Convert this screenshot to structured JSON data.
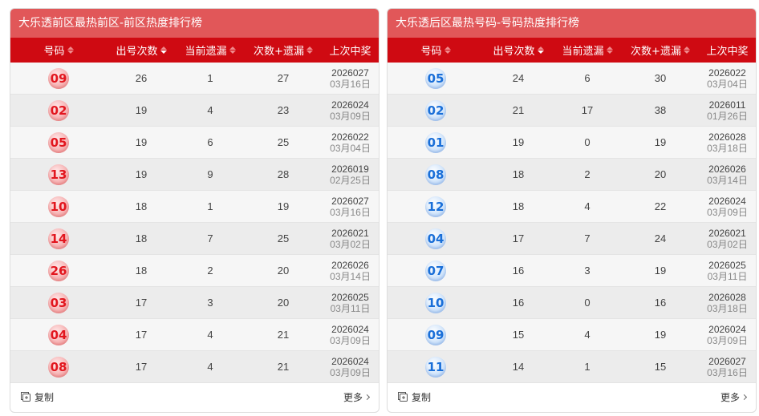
{
  "colors": {
    "header_red": "#cf0a12",
    "title_red": "#e15759",
    "front_ball": "#e2161e",
    "back_ball": "#1a6fd8"
  },
  "icons": {
    "sort": "sort-arrows-icon",
    "copy": "copy-icon",
    "more": "chevron-right-icon"
  },
  "front": {
    "title": "大乐透前区最热前区-前区热度排行榜",
    "headers": {
      "number": "号码",
      "count": "出号次数",
      "miss": "当前遗漏",
      "sum": "次数+遗漏",
      "last": "上次中奖"
    },
    "rows": [
      {
        "ball": "09",
        "count": "26",
        "miss": "1",
        "sum": "27",
        "issue": "2026027",
        "date": "03月16日"
      },
      {
        "ball": "02",
        "count": "19",
        "miss": "4",
        "sum": "23",
        "issue": "2026024",
        "date": "03月09日"
      },
      {
        "ball": "05",
        "count": "19",
        "miss": "6",
        "sum": "25",
        "issue": "2026022",
        "date": "03月04日"
      },
      {
        "ball": "13",
        "count": "19",
        "miss": "9",
        "sum": "28",
        "issue": "2026019",
        "date": "02月25日"
      },
      {
        "ball": "10",
        "count": "18",
        "miss": "1",
        "sum": "19",
        "issue": "2026027",
        "date": "03月16日"
      },
      {
        "ball": "14",
        "count": "18",
        "miss": "7",
        "sum": "25",
        "issue": "2026021",
        "date": "03月02日"
      },
      {
        "ball": "26",
        "count": "18",
        "miss": "2",
        "sum": "20",
        "issue": "2026026",
        "date": "03月14日"
      },
      {
        "ball": "03",
        "count": "17",
        "miss": "3",
        "sum": "20",
        "issue": "2026025",
        "date": "03月11日"
      },
      {
        "ball": "04",
        "count": "17",
        "miss": "4",
        "sum": "21",
        "issue": "2026024",
        "date": "03月09日"
      },
      {
        "ball": "08",
        "count": "17",
        "miss": "4",
        "sum": "21",
        "issue": "2026024",
        "date": "03月09日"
      }
    ],
    "copy_label": "复制",
    "more_label": "更多"
  },
  "back": {
    "title": "大乐透后区最热号码-号码热度排行榜",
    "headers": {
      "number": "号码",
      "count": "出号次数",
      "miss": "当前遗漏",
      "sum": "次数+遗漏",
      "last": "上次中奖"
    },
    "rows": [
      {
        "ball": "05",
        "count": "24",
        "miss": "6",
        "sum": "30",
        "issue": "2026022",
        "date": "03月04日"
      },
      {
        "ball": "02",
        "count": "21",
        "miss": "17",
        "sum": "38",
        "issue": "2026011",
        "date": "01月26日"
      },
      {
        "ball": "01",
        "count": "19",
        "miss": "0",
        "sum": "19",
        "issue": "2026028",
        "date": "03月18日"
      },
      {
        "ball": "08",
        "count": "18",
        "miss": "2",
        "sum": "20",
        "issue": "2026026",
        "date": "03月14日"
      },
      {
        "ball": "12",
        "count": "18",
        "miss": "4",
        "sum": "22",
        "issue": "2026024",
        "date": "03月09日"
      },
      {
        "ball": "04",
        "count": "17",
        "miss": "7",
        "sum": "24",
        "issue": "2026021",
        "date": "03月02日"
      },
      {
        "ball": "07",
        "count": "16",
        "miss": "3",
        "sum": "19",
        "issue": "2026025",
        "date": "03月11日"
      },
      {
        "ball": "10",
        "count": "16",
        "miss": "0",
        "sum": "16",
        "issue": "2026028",
        "date": "03月18日"
      },
      {
        "ball": "09",
        "count": "15",
        "miss": "4",
        "sum": "19",
        "issue": "2026024",
        "date": "03月09日"
      },
      {
        "ball": "11",
        "count": "14",
        "miss": "1",
        "sum": "15",
        "issue": "2026027",
        "date": "03月16日"
      }
    ],
    "copy_label": "复制",
    "more_label": "更多"
  }
}
